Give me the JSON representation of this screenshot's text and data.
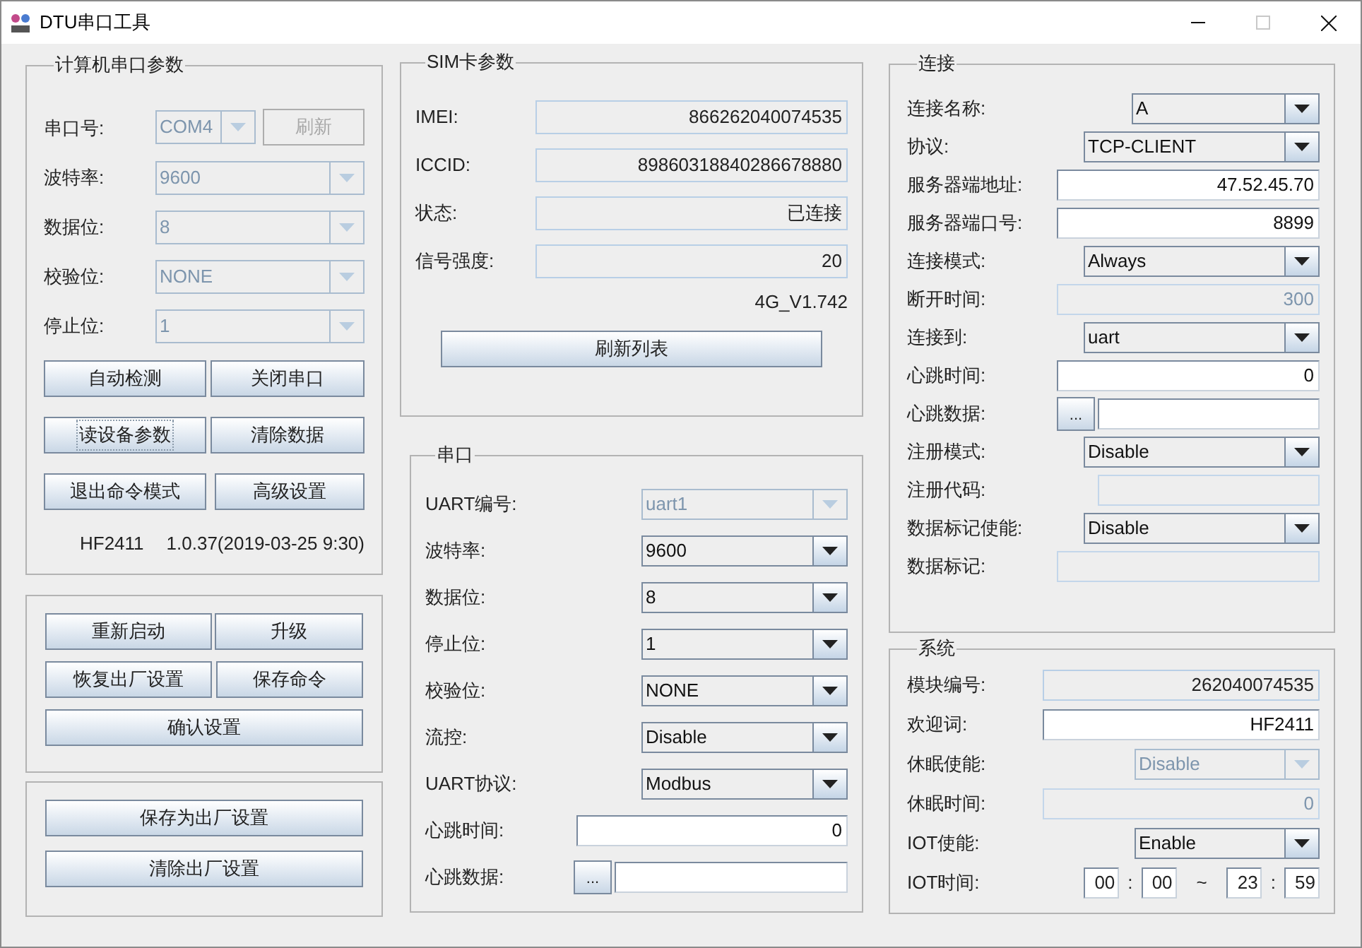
{
  "window": {
    "title": "DTU串口工具"
  },
  "pc_serial": {
    "title": "计算机串口参数",
    "fields": [
      {
        "label": "串口号:",
        "kind": "select",
        "value": "COM4",
        "disabled": true,
        "button": {
          "label": "刷新",
          "disabled": true
        }
      },
      {
        "label": "波特率:",
        "kind": "select",
        "value": "9600",
        "disabled": true
      },
      {
        "label": "数据位:",
        "kind": "select",
        "value": "8",
        "disabled": true
      },
      {
        "label": "校验位:",
        "kind": "select",
        "value": "NONE",
        "disabled": true
      },
      {
        "label": "停止位:",
        "kind": "select",
        "value": "1",
        "disabled": true
      }
    ],
    "button_rows": [
      [
        {
          "label": "自动检测",
          "focused": false
        },
        {
          "label": "关闭串口",
          "focused": false
        }
      ],
      [
        {
          "label": "读设备参数",
          "focused": true
        },
        {
          "label": "清除数据",
          "focused": false
        }
      ],
      [
        {
          "label": "退出命令模式",
          "focused": false
        },
        {
          "label": "高级设置",
          "focused": false
        }
      ]
    ],
    "model": "HF2411",
    "version": "1.0.37(2019-03-25 9:30)"
  },
  "actions": {
    "button_rows": [
      [
        {
          "label": "重新启动"
        },
        {
          "label": "升级"
        }
      ],
      [
        {
          "label": "恢复出厂设置"
        },
        {
          "label": "保存命令"
        }
      ],
      [
        {
          "label": "确认设置"
        }
      ]
    ]
  },
  "factory": {
    "button_rows": [
      [
        {
          "label": "保存为出厂设置"
        }
      ],
      [
        {
          "label": "清除出厂设置"
        }
      ]
    ]
  },
  "sim": {
    "title": "SIM卡参数",
    "fields": [
      {
        "label": "IMEI:",
        "kind": "readonly",
        "value": "866262040074535"
      },
      {
        "label": "ICCID:",
        "kind": "readonly",
        "value": "89860318840286678880"
      },
      {
        "label": "状态:",
        "kind": "readonly",
        "value": "已连接"
      },
      {
        "label": "信号强度:",
        "kind": "readonly",
        "value": "20"
      }
    ],
    "firmware": "4G_V1.742",
    "button": "刷新列表"
  },
  "uart": {
    "title": "串口",
    "fields": [
      {
        "label": "UART编号:",
        "kind": "select",
        "value": "uart1",
        "disabled": true
      },
      {
        "label": "波特率:",
        "kind": "select",
        "value": "9600",
        "disabled": false
      },
      {
        "label": "数据位:",
        "kind": "select",
        "value": "8",
        "disabled": false
      },
      {
        "label": "停止位:",
        "kind": "select",
        "value": "1",
        "disabled": false
      },
      {
        "label": "校验位:",
        "kind": "select",
        "value": "NONE",
        "disabled": false
      },
      {
        "label": "流控:",
        "kind": "select",
        "value": "Disable",
        "disabled": false
      },
      {
        "label": "UART协议:",
        "kind": "select",
        "value": "Modbus",
        "disabled": false
      },
      {
        "label": "心跳时间:",
        "kind": "input",
        "value": "0",
        "disabled": false
      },
      {
        "label": "心跳数据:",
        "kind": "hex",
        "button": "..."
      }
    ]
  },
  "connection": {
    "title": "连接",
    "fields": [
      {
        "label": "连接名称:",
        "kind": "select",
        "value": "A",
        "disabled": false
      },
      {
        "label": "协议:",
        "kind": "select",
        "value": "TCP-CLIENT",
        "disabled": false
      },
      {
        "label": "服务器端地址:",
        "kind": "input",
        "value": "47.52.45.70",
        "disabled": false
      },
      {
        "label": "服务器端口号:",
        "kind": "input",
        "value": "8899",
        "disabled": false
      },
      {
        "label": "连接模式:",
        "kind": "select",
        "value": "Always",
        "disabled": false
      },
      {
        "label": "断开时间:",
        "kind": "input",
        "value": "300",
        "disabled": true
      },
      {
        "label": "连接到:",
        "kind": "select",
        "value": "uart",
        "disabled": false
      },
      {
        "label": "心跳时间:",
        "kind": "input",
        "value": "0",
        "disabled": false
      },
      {
        "label": "心跳数据:",
        "kind": "hex",
        "button": "..."
      },
      {
        "label": "注册模式:",
        "kind": "select",
        "value": "Disable",
        "disabled": false
      },
      {
        "label": "注册代码:",
        "kind": "input",
        "disabled": true
      },
      {
        "label": "数据标记使能:",
        "kind": "select",
        "value": "Disable",
        "disabled": false
      },
      {
        "label": "数据标记:",
        "kind": "input",
        "disabled": true
      }
    ]
  },
  "system": {
    "title": "系统",
    "fields": [
      {
        "label": "模块编号:",
        "kind": "readonly",
        "value": "262040074535"
      },
      {
        "label": "欢迎词:",
        "kind": "input",
        "value": "HF2411",
        "disabled": false
      },
      {
        "label": "休眠使能:",
        "kind": "select",
        "value": "Disable",
        "disabled": true
      },
      {
        "label": "休眠时间:",
        "kind": "input",
        "value": "0",
        "disabled": true
      },
      {
        "label": "IOT使能:",
        "kind": "select",
        "value": "Enable",
        "disabled": false
      },
      {
        "label": "IOT时间:",
        "kind": "time",
        "values": [
          "00",
          "00",
          "23",
          "59"
        ],
        "separators": [
          ":",
          "~",
          ":"
        ]
      }
    ]
  }
}
